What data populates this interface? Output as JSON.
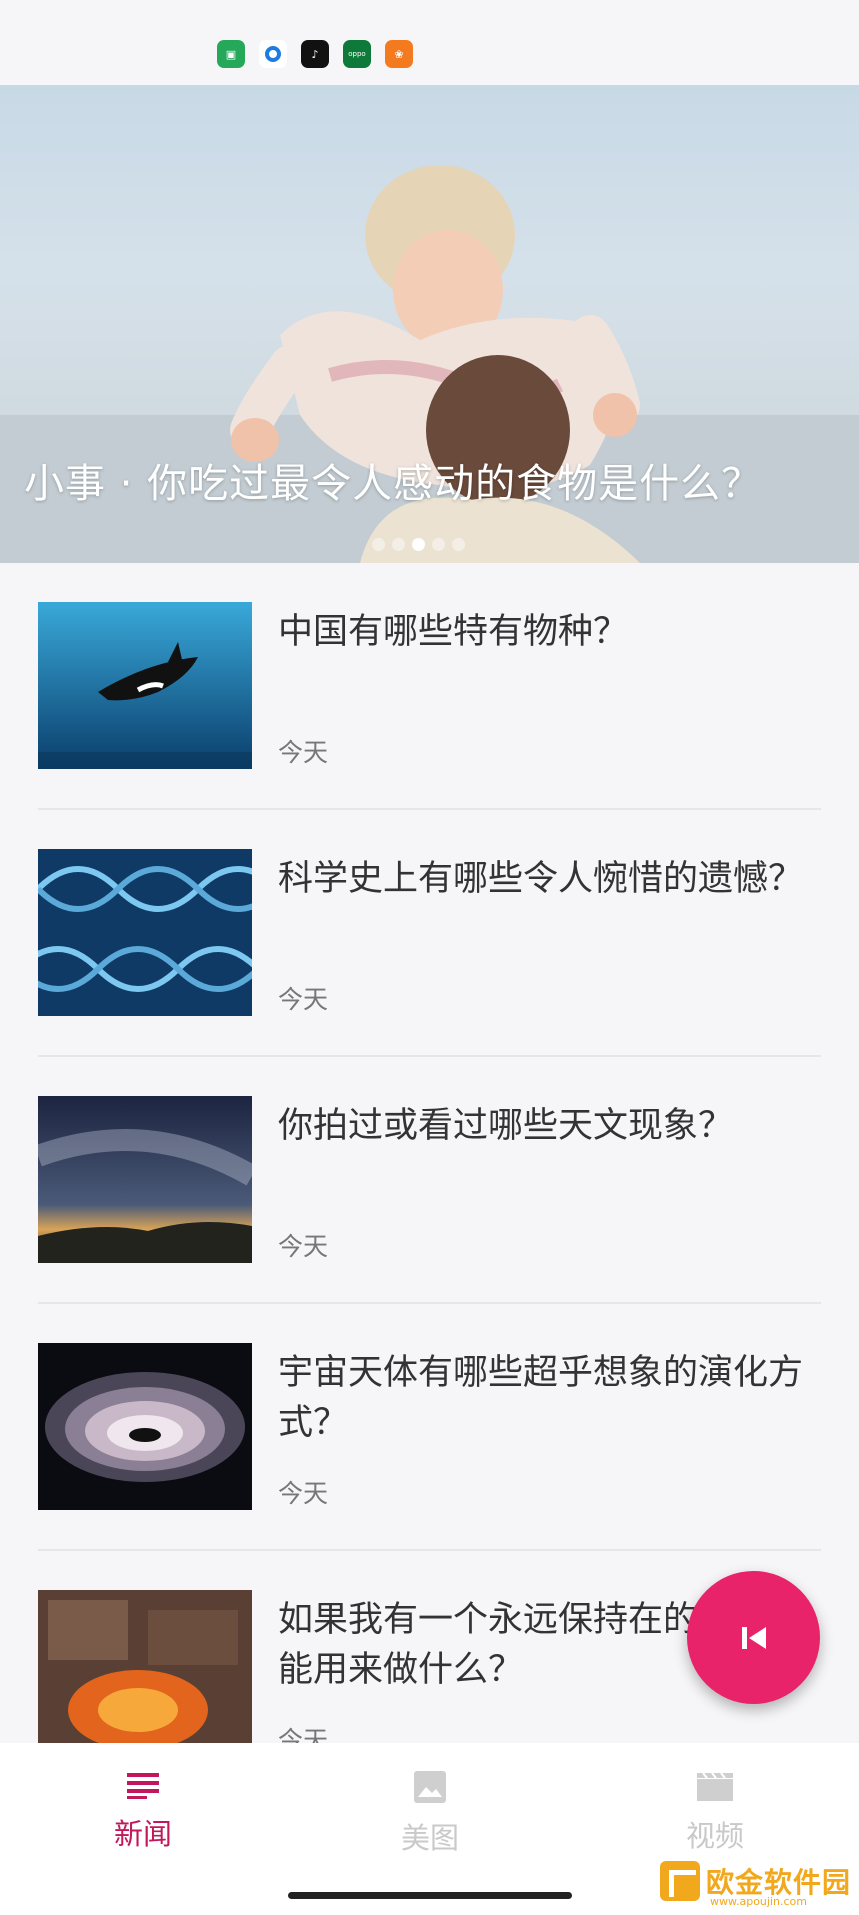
{
  "status_bar": {
    "icons": [
      "store-icon",
      "circle-app-icon",
      "tiktok-icon",
      "oppo-icon",
      "paw-app-icon"
    ]
  },
  "banner": {
    "title": "小事 · 你吃过最令人感动的食物是什么？",
    "dots_count": 5,
    "active_dot": 3
  },
  "news": [
    {
      "title": "中国有哪些特有物种？",
      "date": "今天",
      "thumb": "orca-image"
    },
    {
      "title": "科学史上有哪些令人惋惜的遗憾？",
      "date": "今天",
      "thumb": "dna-image"
    },
    {
      "title": "你拍过或看过哪些天文现象？",
      "date": "今天",
      "thumb": "milky-way-image"
    },
    {
      "title": "宇宙天体有哪些超乎想象的演化方式？",
      "date": "今天",
      "thumb": "vortex-image"
    },
    {
      "title": "如果我有一个永远保持在的方块，能用来做什么？",
      "date": "今天",
      "thumb": "lava-image"
    }
  ],
  "fab": {
    "icon": "skip-previous-icon"
  },
  "bottom_nav": {
    "items": [
      {
        "label": "新闻",
        "icon": "list-icon",
        "active": true
      },
      {
        "label": "美图",
        "icon": "image-icon",
        "active": false
      },
      {
        "label": "视频",
        "icon": "film-icon",
        "active": false
      }
    ]
  },
  "colors": {
    "accent": "#e8236a",
    "active_nav": "#c2185b",
    "inactive_nav": "#c9c9c9"
  },
  "watermark": {
    "text": "欧金软件园",
    "sub": "www.apoujin.com"
  }
}
